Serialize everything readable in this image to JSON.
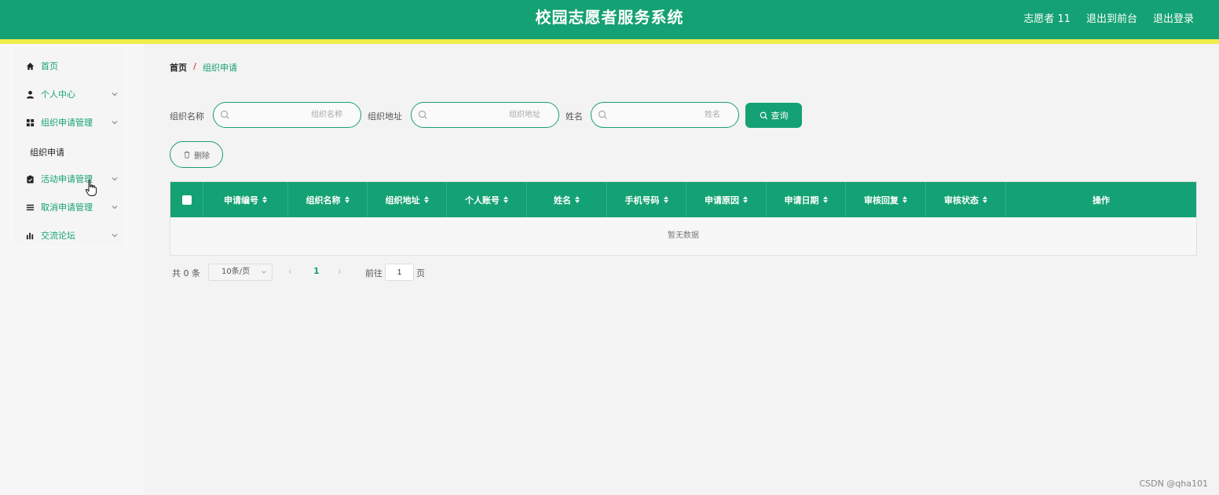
{
  "header": {
    "title": "校园志愿者服务系统",
    "user": "志愿者 11",
    "back_to_front": "退出到前台",
    "logout": "退出登录"
  },
  "sidebar": {
    "items": [
      {
        "label": "首页",
        "icon": "home-icon"
      },
      {
        "label": "个人中心",
        "icon": "user-icon"
      },
      {
        "label": "组织申请管理",
        "icon": "grid-icon"
      },
      {
        "label": "活动申请管理",
        "icon": "clipboard-icon"
      },
      {
        "label": "取消申请管理",
        "icon": "list-icon"
      },
      {
        "label": "交流论坛",
        "icon": "bar-chart-icon"
      }
    ],
    "active_sub": "组织申请"
  },
  "breadcrumb": {
    "home": "首页",
    "separator": "/",
    "current": "组织申请"
  },
  "search": {
    "org_name_label": "组织名称",
    "org_name_placeholder": "组织名称",
    "org_addr_label": "组织地址",
    "org_addr_placeholder": "组织地址",
    "name_label": "姓名",
    "name_placeholder": "姓名",
    "query_label": "查询"
  },
  "actions": {
    "delete_label": "删除"
  },
  "table": {
    "columns": [
      "申请编号",
      "组织名称",
      "组织地址",
      "个人账号",
      "姓名",
      "手机号码",
      "申请原因",
      "申请日期",
      "审核回复",
      "审核状态",
      "操作"
    ],
    "empty_text": "暂无数据"
  },
  "pagination": {
    "total": "共 0 条",
    "page_size": "10条/页",
    "current_page": "1",
    "goto_label": "前往",
    "goto_value": "1",
    "goto_suffix": "页"
  },
  "watermark": "CSDN @qha101",
  "colors": {
    "primary": "#14a173",
    "accent_stripe": "#f0ec4a",
    "breadcrumb_separator": "#e24a3b"
  }
}
